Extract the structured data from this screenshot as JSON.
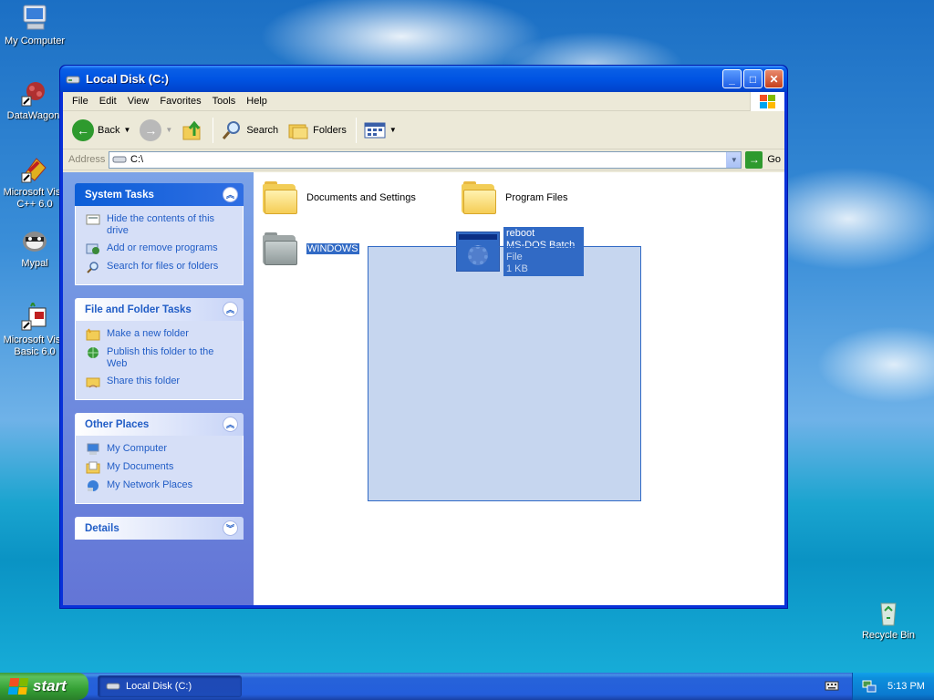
{
  "desktop": {
    "icons": [
      {
        "label": "My Computer",
        "icon": "my-computer-icon"
      },
      {
        "label": "DataWagon.",
        "icon": "datawagon-icon"
      },
      {
        "label": "Microsoft Visu C++ 6.0",
        "icon": "visual-cpp-icon"
      },
      {
        "label": "Mypal",
        "icon": "mypal-browser-icon"
      },
      {
        "label": "Microsoft Visu Basic 6.0",
        "icon": "visual-basic-icon"
      },
      {
        "label": "Recycle Bin",
        "icon": "recycle-bin-icon"
      }
    ]
  },
  "window": {
    "title": "Local Disk (C:)",
    "menu": [
      "File",
      "Edit",
      "View",
      "Favorites",
      "Tools",
      "Help"
    ],
    "toolbar": {
      "back": "Back",
      "search": "Search",
      "folders": "Folders"
    },
    "address": {
      "label": "Address",
      "value": "C:\\",
      "go": "Go"
    },
    "taskpane": {
      "system_tasks": {
        "title": "System Tasks",
        "items": [
          "Hide the contents of this drive",
          "Add or remove programs",
          "Search for files or folders"
        ]
      },
      "file_folder_tasks": {
        "title": "File and Folder Tasks",
        "items": [
          "Make a new folder",
          "Publish this folder to the Web",
          "Share this folder"
        ]
      },
      "other_places": {
        "title": "Other Places",
        "items": [
          "My Computer",
          "My Documents",
          "My Network Places"
        ]
      },
      "details": {
        "title": "Details"
      }
    },
    "files": [
      {
        "name": "Documents and Settings",
        "type": "folder"
      },
      {
        "name": "Program Files",
        "type": "folder"
      },
      {
        "name": "WINDOWS",
        "type": "folder",
        "selected": true
      },
      {
        "name": "reboot",
        "type": "MS-DOS Batch File",
        "size": "1 KB",
        "selected": true
      }
    ]
  },
  "taskbar": {
    "start": "start",
    "task": "Local Disk (C:)",
    "clock": "5:13 PM"
  },
  "colors": {
    "title_blue": "#0054e3",
    "selection": "#316ac5",
    "taskpane_link": "#215dc6"
  }
}
